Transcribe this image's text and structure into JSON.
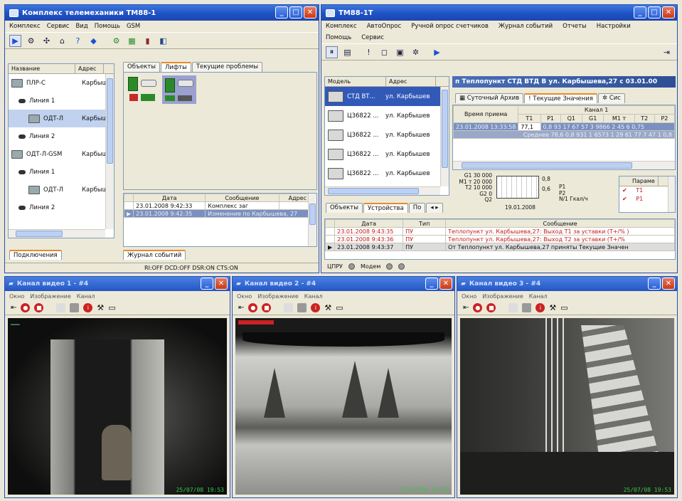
{
  "win1": {
    "title": "Комплекс телемеханики ТМ88-1",
    "menu": [
      "Комплекс",
      "Сервис",
      "Вид",
      "Помощь",
      "GSM"
    ],
    "tree_headers": [
      "Название",
      "Адрес"
    ],
    "tree": [
      {
        "label": "ПЛР-С",
        "addr": "Карбыш",
        "icon": "device-icon"
      },
      {
        "label": "Линия 1",
        "addr": "",
        "icon": "line-icon"
      },
      {
        "label": "ОДТ-Л",
        "addr": "Карбыш",
        "icon": "meter-icon",
        "selected": true
      },
      {
        "label": "Линия 2",
        "addr": "",
        "icon": "line-icon"
      },
      {
        "label": "ОДТ-Л-GSM",
        "addr": "Карбыш",
        "icon": "gsm-icon"
      },
      {
        "label": "Линия 1",
        "addr": "",
        "icon": "line-icon"
      },
      {
        "label": "ОДТ-Л",
        "addr": "Карбыш",
        "icon": "meter-icon"
      },
      {
        "label": "Линия 2",
        "addr": "",
        "icon": "line-icon"
      }
    ],
    "left_tab": "Подключения",
    "right_tabs": [
      "Объекты",
      "Лифты",
      "Текущие проблемы"
    ],
    "journal_headers": [
      "Дата",
      "Сообщение",
      "Адрес"
    ],
    "journal": [
      {
        "date": "23.01.2008 9:42:33",
        "msg": "Комплекс заг",
        "addr": ""
      },
      {
        "date": "23.01.2008 9:42:35",
        "msg": "Изменение по Карбышева, 27",
        "addr": "",
        "selected": true
      }
    ],
    "journal_tab": "Журнал событий",
    "status": "RI:OFF DCD:OFF DSR:ON CTS:ON"
  },
  "win2": {
    "title": "ТМ88-1Т",
    "menu": [
      "Комплекс",
      "АвтоОпрос",
      "Ручной опрос счетчиков",
      "Журнал событий",
      "Отчеты",
      "Настройки"
    ],
    "menu2": [
      "Помощь",
      "Сервис"
    ],
    "dev_headers": [
      "Модель",
      "Адрес"
    ],
    "devices": [
      {
        "model": "СТД ВТ...",
        "addr": "ул. Карбышев",
        "selected": true
      },
      {
        "model": "Ц36822 ...",
        "addr": "ул. Карбышев"
      },
      {
        "model": "Ц36822 ...",
        "addr": "ул. Карбышев"
      },
      {
        "model": "Ц36822 ...",
        "addr": "ул. Карбышев"
      },
      {
        "model": "Ц36822 ...",
        "addr": "ул. Карбышев"
      }
    ],
    "dev_tabs": [
      "Объекты",
      "Устройства",
      "По"
    ],
    "banner": "п Теплопункт СТД ВТД В ул. Карбышева,27 с 03.01.00",
    "data_tabs": [
      "Суточный Архив",
      "Текущие Значения",
      "Сис"
    ],
    "recv_time_label": "Время приема",
    "channel_label": "Канал 1",
    "cols": [
      "T1",
      "P1",
      "Q1",
      "G1",
      "M1 т",
      "T2",
      "P2"
    ],
    "row1_time": "23.01.2008 13:33:58",
    "row1_t1": "77,1",
    "row1_rest": "0,8 93 17 67 57 3 9866 2 45 6 0,75",
    "row2": "Среднее  78,6  0,8 931 1 6573 1 29 61 77 7 47 1 0,8",
    "graph_labels": [
      "G1 30 000",
      "M1 т 20 000",
      "T2 10 000",
      "G2 0",
      "Q2"
    ],
    "graph_right": [
      "0,8",
      "0,6"
    ],
    "graph_legend": [
      "P1",
      "P2",
      "N/1 Гкал/ч"
    ],
    "graph_date": "19.01.2008",
    "param_head": "Парамe",
    "params": [
      "T1",
      "P1"
    ],
    "events_headers": [
      "Дата",
      "Тип",
      "Сообщение"
    ],
    "events": [
      {
        "date": "23.01.2008 9:43:35",
        "type": "ПУ",
        "msg": "Теплопункт ул. Карбышева,27: Выход Т1 за уставки (Т+/% )",
        "red": true
      },
      {
        "date": "23.01.2008 9:43:36",
        "type": "ПУ",
        "msg": "Теплопункт ул. Карбышева,27: Выход Т2 за уставки (Т+/%",
        "red": true
      },
      {
        "date": "23.01.2008 9:43:37",
        "type": "ПУ",
        "msg": "От Теплопункт ул. Карбышева,27 приняты Текущие Значен",
        "red": false,
        "selected": true
      }
    ],
    "status": [
      "ЦПРУ",
      "Модем"
    ]
  },
  "videos": [
    {
      "title": "Канал видео 1 - #4",
      "menu": [
        "Окно",
        "Изображение",
        "Канал"
      ],
      "stamp": "25/07/08 19:53"
    },
    {
      "title": "Канал видео 2 - #4",
      "menu": [
        "Окно",
        "Изображение",
        "Канал"
      ],
      "stamp": "25/07/08 19:53"
    },
    {
      "title": "Канал видео 3 - #4",
      "menu": [
        "Окно",
        "Изображение",
        "Канал"
      ],
      "stamp": "25/07/08 19:53"
    }
  ],
  "colors": {
    "title_blue": "#1e52c4",
    "alarm_red": "#c21a1a",
    "stamp_green": "#39c64a"
  }
}
